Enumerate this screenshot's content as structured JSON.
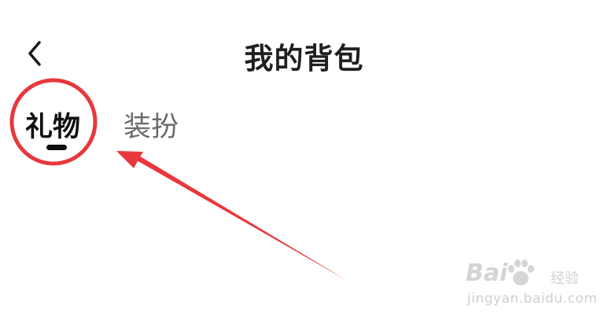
{
  "header": {
    "title": "我的背包",
    "back_icon": "chevron-left-icon"
  },
  "tabs": [
    {
      "label": "礼物",
      "active": true
    },
    {
      "label": "装扮",
      "active": false
    }
  ],
  "annotation": {
    "color": "#e8383d"
  },
  "watermark": {
    "brand": "Bai",
    "brand_suffix": "经验",
    "domain": "jingyan.baidu.com"
  }
}
